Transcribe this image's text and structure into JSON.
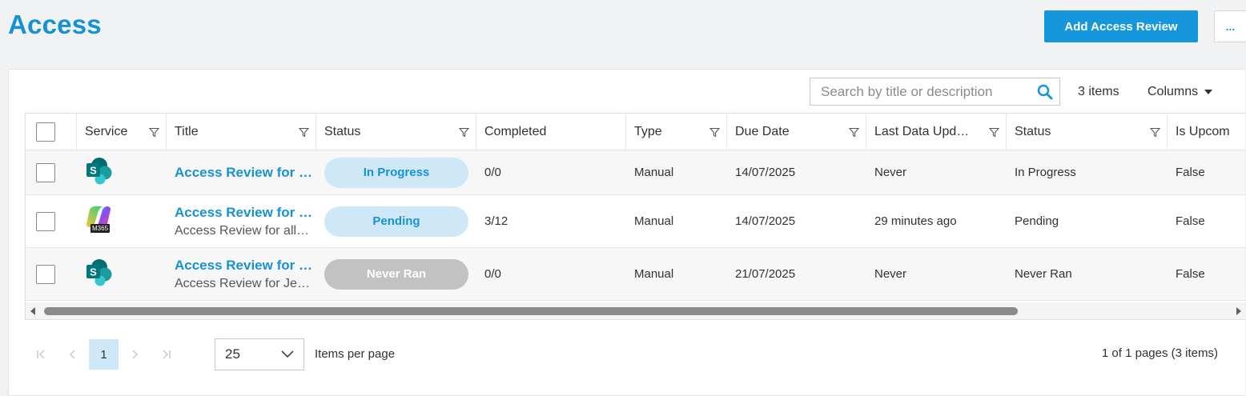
{
  "page": {
    "title": "Access"
  },
  "toolbar": {
    "add_label": "Add Access Review",
    "more_label": "..."
  },
  "search": {
    "placeholder": "Search by title or description"
  },
  "items_count": "3 items",
  "columns_label": "Columns",
  "columns": [
    {
      "label": "",
      "filter": false
    },
    {
      "label": "Service",
      "filter": true
    },
    {
      "label": "Title",
      "filter": true
    },
    {
      "label": "Status",
      "filter": true
    },
    {
      "label": "Completed",
      "filter": false
    },
    {
      "label": "Type",
      "filter": true
    },
    {
      "label": "Due Date",
      "filter": true
    },
    {
      "label": "Last Data Upd…",
      "filter": true
    },
    {
      "label": "Status",
      "filter": true
    },
    {
      "label": "Is Upcom",
      "filter": false
    }
  ],
  "rows": [
    {
      "service": "sharepoint",
      "title": "Access Review for …",
      "subtitle": "",
      "status": "In Progress",
      "status_style": "blue",
      "completed": "0/0",
      "type": "Manual",
      "due_date": "14/07/2025",
      "last_update": "Never",
      "status2": "In Progress",
      "is_upcoming": "False"
    },
    {
      "service": "m365",
      "title": "Access Review for …",
      "subtitle": "Access Review for all…",
      "status": "Pending",
      "status_style": "blue",
      "completed": "3/12",
      "type": "Manual",
      "due_date": "14/07/2025",
      "last_update": "29 minutes ago",
      "status2": "Pending",
      "is_upcoming": "False"
    },
    {
      "service": "sharepoint",
      "title": "Access Review for …",
      "subtitle": "Access Review for Je…",
      "status": "Never Ran",
      "status_style": "grey",
      "completed": "0/0",
      "type": "Manual",
      "due_date": "21/07/2025",
      "last_update": "Never",
      "status2": "Never Ran",
      "is_upcoming": "False"
    }
  ],
  "service_badges": {
    "m365": "M365"
  },
  "pager": {
    "current_page": "1",
    "page_size": "25",
    "page_size_label": "Items per page",
    "info": "1 of 1 pages (3 items)"
  },
  "colors": {
    "accent": "#1596dd",
    "pill_blue": "#cfe8f7",
    "pill_grey": "#c2c2c2",
    "sharepoint": "#0b7a74"
  }
}
